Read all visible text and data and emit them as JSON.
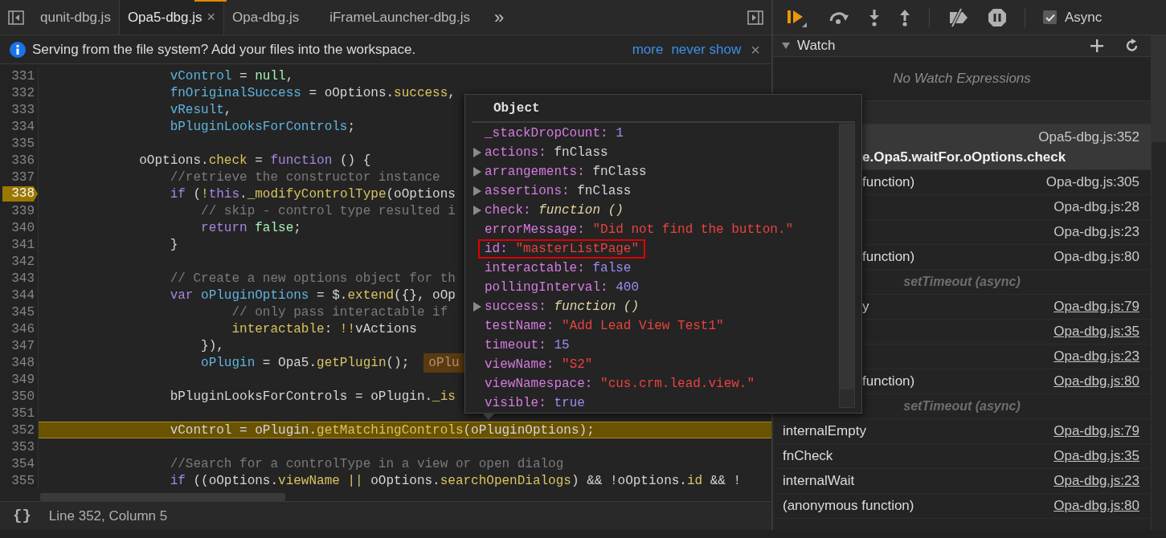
{
  "editor": {
    "tabs": [
      {
        "label": "qunit-dbg.js",
        "selected": false
      },
      {
        "label": "Opa5-dbg.js",
        "selected": true,
        "close": "×"
      },
      {
        "label": "Opa-dbg.js",
        "selected": false
      },
      {
        "label": "iFrameLauncher-dbg.js",
        "selected": false
      }
    ],
    "more": "»"
  },
  "banner": {
    "message": "Serving from the file system? Add your files into the workspace.",
    "links": [
      "more",
      "never show"
    ],
    "close": "×"
  },
  "code": {
    "lines": [
      {
        "number": "331",
        "breakpoint": false,
        "current": false,
        "tokens": [
          {
            "text": "                vControl",
            "kind": "var"
          },
          {
            "text": " = ",
            "kind": "plain"
          },
          {
            "text": "null",
            "kind": "literal"
          },
          {
            "text": ",",
            "kind": "plain"
          }
        ]
      },
      {
        "number": "332",
        "breakpoint": false,
        "current": false,
        "tokens": [
          {
            "text": "                fnOriginalSuccess",
            "kind": "var"
          },
          {
            "text": " = oOptions.",
            "kind": "plain"
          },
          {
            "text": "success",
            "kind": "member"
          },
          {
            "text": ",",
            "kind": "plain"
          }
        ]
      },
      {
        "number": "333",
        "breakpoint": false,
        "current": false,
        "tokens": [
          {
            "text": "                vResult",
            "kind": "var"
          },
          {
            "text": ",",
            "kind": "plain"
          }
        ]
      },
      {
        "number": "334",
        "breakpoint": false,
        "current": false,
        "tokens": [
          {
            "text": "                bPluginLooksForControls",
            "kind": "var"
          },
          {
            "text": ";",
            "kind": "plain"
          }
        ]
      },
      {
        "number": "335",
        "breakpoint": false,
        "current": false
      },
      {
        "number": "336",
        "breakpoint": false,
        "current": false,
        "tokens": [
          {
            "text": "            oOptions.",
            "kind": "plain"
          },
          {
            "text": "check",
            "kind": "member"
          },
          {
            "text": " = ",
            "kind": "plain"
          },
          {
            "text": "function",
            "kind": "keyword"
          },
          {
            "text": " () {",
            "kind": "plain"
          }
        ]
      },
      {
        "number": "337",
        "breakpoint": false,
        "current": false,
        "tokens": [
          {
            "text": "                //retrieve the constructor instance",
            "kind": "comment"
          }
        ]
      },
      {
        "number": "338",
        "breakpoint": true,
        "current": false,
        "tokens": [
          {
            "text": "                if",
            "kind": "keyword"
          },
          {
            "text": " (",
            "kind": "plain"
          },
          {
            "text": "!",
            "kind": "member"
          },
          {
            "text": "this",
            "kind": "keyword"
          },
          {
            "text": ".",
            "kind": "plain"
          },
          {
            "text": "_modifyControlType",
            "kind": "member"
          },
          {
            "text": "(oOptions",
            "kind": "plain"
          }
        ]
      },
      {
        "number": "339",
        "breakpoint": false,
        "current": false,
        "tokens": [
          {
            "text": "                    // skip - control type resulted i",
            "kind": "comment"
          }
        ]
      },
      {
        "number": "340",
        "breakpoint": false,
        "current": false,
        "tokens": [
          {
            "text": "                    return ",
            "kind": "keyword"
          },
          {
            "text": "false",
            "kind": "literal"
          },
          {
            "text": ";",
            "kind": "plain"
          }
        ]
      },
      {
        "number": "341",
        "breakpoint": false,
        "current": false,
        "tokens": [
          {
            "text": "                }",
            "kind": "plain"
          }
        ]
      },
      {
        "number": "342",
        "breakpoint": false,
        "current": false
      },
      {
        "number": "343",
        "breakpoint": false,
        "current": false,
        "tokens": [
          {
            "text": "                // Create a new options object for th",
            "kind": "comment"
          }
        ]
      },
      {
        "number": "344",
        "breakpoint": false,
        "current": false,
        "tokens": [
          {
            "text": "                var ",
            "kind": "keyword"
          },
          {
            "text": "oPluginOptions",
            "kind": "var"
          },
          {
            "text": " = $.",
            "kind": "plain"
          },
          {
            "text": "extend",
            "kind": "member"
          },
          {
            "text": "({}, oOp",
            "kind": "plain"
          }
        ]
      },
      {
        "number": "345",
        "breakpoint": false,
        "current": false,
        "tokens": [
          {
            "text": "                        // only pass interactable if",
            "kind": "comment"
          }
        ]
      },
      {
        "number": "346",
        "breakpoint": false,
        "current": false,
        "tokens": [
          {
            "text": "                        interactable",
            "kind": "member"
          },
          {
            "text": ": ",
            "kind": "plain"
          },
          {
            "text": "!!",
            "kind": "member"
          },
          {
            "text": "vActions",
            "kind": "plain"
          }
        ]
      },
      {
        "number": "347",
        "breakpoint": false,
        "current": false,
        "tokens": [
          {
            "text": "                    }),",
            "kind": "plain"
          }
        ]
      },
      {
        "number": "348",
        "breakpoint": false,
        "current": false,
        "inline_value": "oPlu",
        "tokens": [
          {
            "text": "                    oPlugin",
            "kind": "var"
          },
          {
            "text": " = Opa5.",
            "kind": "plain"
          },
          {
            "text": "getPlugin",
            "kind": "member"
          },
          {
            "text": "();",
            "kind": "plain"
          }
        ]
      },
      {
        "number": "349",
        "breakpoint": false,
        "current": false
      },
      {
        "number": "350",
        "breakpoint": false,
        "current": false,
        "tokens": [
          {
            "text": "                bPluginLooksForControls = oPlugin.",
            "kind": "plain"
          },
          {
            "text": "_is",
            "kind": "member"
          }
        ]
      },
      {
        "number": "351",
        "breakpoint": false,
        "current": false
      },
      {
        "number": "352",
        "breakpoint": false,
        "current": true,
        "tokens": [
          {
            "text": "                vControl = oPlugin.",
            "kind": "plain"
          },
          {
            "text": "getMatchingControls",
            "kind": "member"
          },
          {
            "text": "(oPluginOptions);",
            "kind": "plain"
          }
        ]
      },
      {
        "number": "353",
        "breakpoint": false,
        "current": false
      },
      {
        "number": "354",
        "breakpoint": false,
        "current": false,
        "tokens": [
          {
            "text": "                //Search for a controlType in a view or open dialog",
            "kind": "comment"
          }
        ]
      },
      {
        "number": "355",
        "breakpoint": false,
        "current": false,
        "tokens": [
          {
            "text": "                if",
            "kind": "keyword"
          },
          {
            "text": " ((oOptions.",
            "kind": "plain"
          },
          {
            "text": "viewName",
            "kind": "member"
          },
          {
            "text": " || ",
            "kind": "member"
          },
          {
            "text": "oOptions.",
            "kind": "plain"
          },
          {
            "text": "searchOpenDialogs",
            "kind": "member"
          },
          {
            "text": ") && !oOptions.",
            "kind": "plain"
          },
          {
            "text": "id",
            "kind": "member"
          },
          {
            "text": " && !",
            "kind": "plain"
          }
        ]
      }
    ]
  },
  "status_bar": {
    "format_button": "{}",
    "position": "Line 352, Column 5"
  },
  "popup": {
    "title": "Object",
    "properties": [
      {
        "name": "_stackDropCount:",
        "value": "1",
        "kind": "number",
        "expandable": false,
        "highlighted": false
      },
      {
        "name": "actions:",
        "value": "fnClass",
        "kind": "object",
        "expandable": true,
        "highlighted": false
      },
      {
        "name": "arrangements:",
        "value": "fnClass",
        "kind": "object",
        "expandable": true,
        "highlighted": false
      },
      {
        "name": "assertions:",
        "value": "fnClass",
        "kind": "object",
        "expandable": true,
        "highlighted": false
      },
      {
        "name": "check:",
        "value": "function ()",
        "kind": "function",
        "expandable": true,
        "highlighted": false
      },
      {
        "name": "errorMessage:",
        "value": "\"Did not find the button.\"",
        "kind": "string",
        "expandable": false,
        "highlighted": false
      },
      {
        "name": "id:",
        "value": "\"masterListPage\"",
        "kind": "string",
        "expandable": false,
        "highlighted": true
      },
      {
        "name": "interactable:",
        "value": "false",
        "kind": "boolean",
        "expandable": false,
        "highlighted": false
      },
      {
        "name": "pollingInterval:",
        "value": "400",
        "kind": "number",
        "expandable": false,
        "highlighted": false
      },
      {
        "name": "success:",
        "value": "function ()",
        "kind": "function",
        "expandable": true,
        "highlighted": false
      },
      {
        "name": "testName:",
        "value": "\"Add Lead View Test1\"",
        "kind": "string",
        "expandable": false,
        "highlighted": false
      },
      {
        "name": "timeout:",
        "value": "15",
        "kind": "number",
        "expandable": false,
        "highlighted": false
      },
      {
        "name": "viewName:",
        "value": "\"S2\"",
        "kind": "string",
        "expandable": false,
        "highlighted": false
      },
      {
        "name": "viewNamespace:",
        "value": "\"cus.crm.lead.view.\"",
        "kind": "string",
        "expandable": false,
        "highlighted": false
      },
      {
        "name": "visible:",
        "value": "true",
        "kind": "boolean",
        "expandable": false,
        "highlighted": false
      }
    ]
  },
  "debugger": {
    "async": {
      "label": "Async",
      "checked": true
    },
    "watch": {
      "title": "Watch",
      "expanded": true,
      "empty_text": "No Watch Expressions"
    },
    "call_stack": [
      {
        "kind": "frame",
        "name": "e.Opa5.waitFor.oOptions.check",
        "source": "Opa5-dbg.js:352",
        "selected": true,
        "covered": true,
        "underlined": false
      },
      {
        "kind": "frame",
        "name": "function)",
        "source": "Opa-dbg.js:305",
        "selected": false,
        "covered": true,
        "underlined": false
      },
      {
        "kind": "frame",
        "source": "Opa-dbg.js:28",
        "selected": false,
        "covered": true,
        "underlined": false
      },
      {
        "kind": "frame",
        "source": "Opa-dbg.js:23",
        "selected": false,
        "covered": true,
        "underlined": false
      },
      {
        "kind": "frame",
        "name": "function)",
        "source": "Opa-dbg.js:80",
        "selected": false,
        "covered": true,
        "underlined": false
      },
      {
        "kind": "async",
        "label": "setTimeout (async)"
      },
      {
        "kind": "frame",
        "name": "y",
        "source": "Opa-dbg.js:79",
        "selected": false,
        "covered": true,
        "underlined": true
      },
      {
        "kind": "frame",
        "source": "Opa-dbg.js:35",
        "selected": false,
        "covered": true,
        "underlined": true
      },
      {
        "kind": "frame",
        "source": "Opa-dbg.js:23",
        "selected": false,
        "covered": true,
        "underlined": true
      },
      {
        "kind": "frame",
        "name": "function)",
        "source": "Opa-dbg.js:80",
        "selected": false,
        "covered": true,
        "underlined": true
      },
      {
        "kind": "async",
        "label": "setTimeout (async)"
      },
      {
        "kind": "frame",
        "name": "internalEmpty",
        "source": "Opa-dbg.js:79",
        "selected": false,
        "covered": false,
        "underlined": true
      },
      {
        "kind": "frame",
        "name": "fnCheck",
        "source": "Opa-dbg.js:35",
        "selected": false,
        "covered": false,
        "underlined": true
      },
      {
        "kind": "frame",
        "name": "internalWait",
        "source": "Opa-dbg.js:23",
        "selected": false,
        "covered": false,
        "underlined": true
      },
      {
        "kind": "frame",
        "name": "(anonymous function)",
        "source": "Opa-dbg.js:80",
        "selected": false,
        "covered": false,
        "underlined": true
      }
    ]
  }
}
